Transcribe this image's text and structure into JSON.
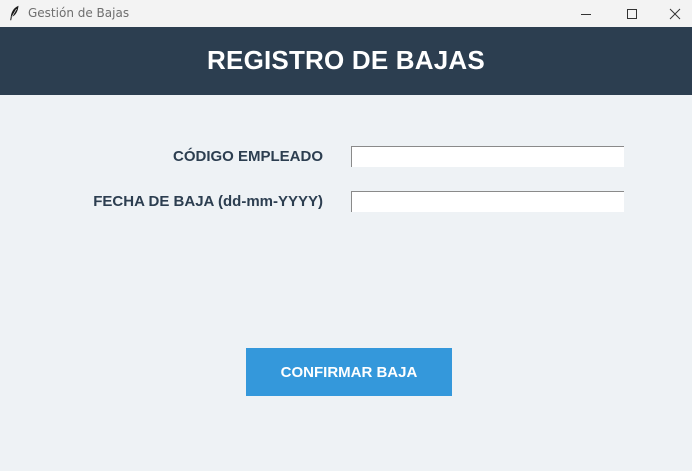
{
  "window": {
    "title": "Gestión de Bajas",
    "icon": "feather-icon"
  },
  "header": {
    "title": "REGISTRO DE BAJAS",
    "background": "#2c3e50"
  },
  "form": {
    "codigo_label": "CÓDIGO EMPLEADO",
    "codigo_value": "",
    "fecha_label": "FECHA DE BAJA (dd-mm-YYYY)",
    "fecha_value": ""
  },
  "actions": {
    "confirm_label": "CONFIRMAR BAJA",
    "confirm_color": "#3498db"
  }
}
